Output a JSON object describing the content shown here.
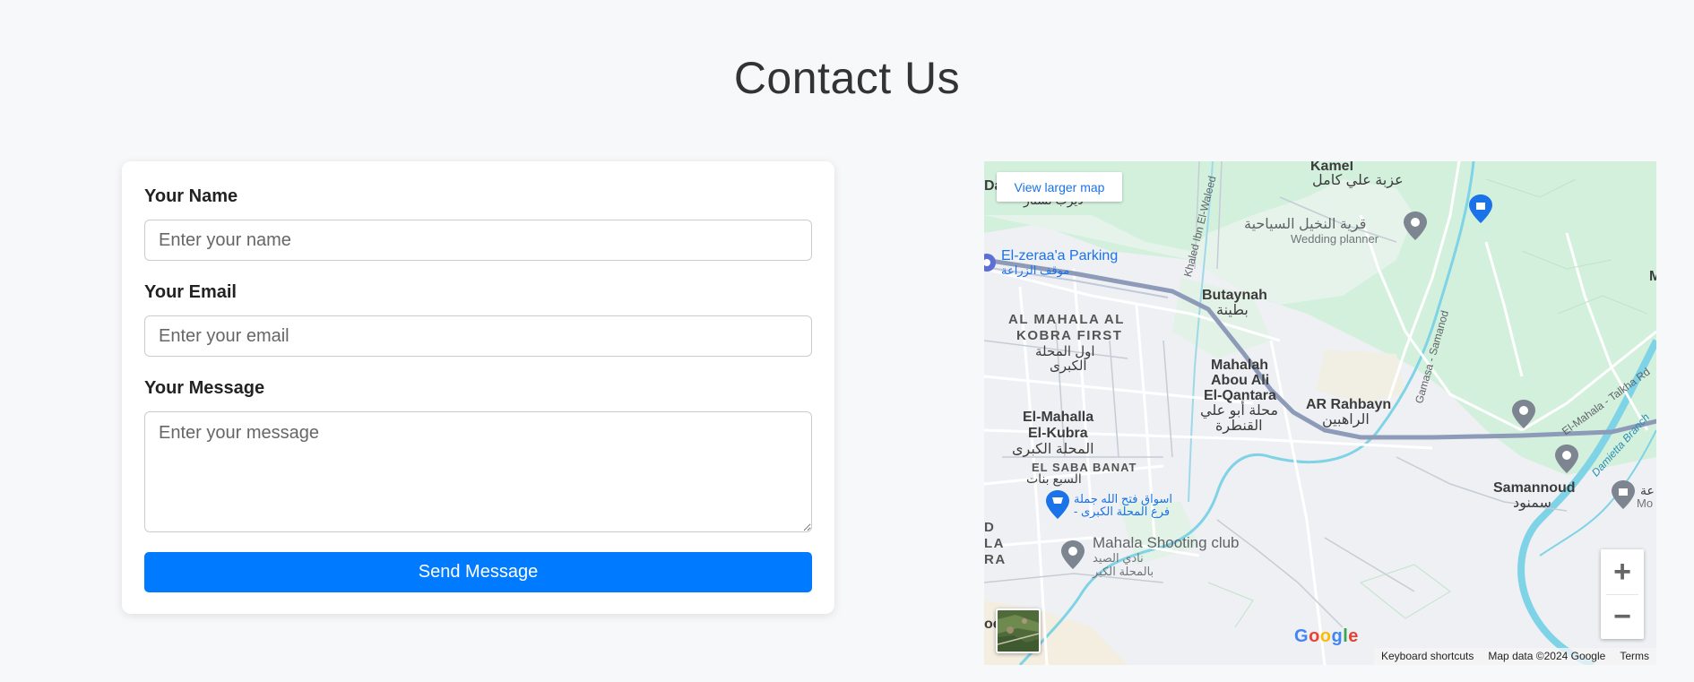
{
  "page": {
    "title": "Contact Us"
  },
  "form": {
    "name_label": "Your Name",
    "name_placeholder": "Enter your name",
    "email_label": "Your Email",
    "email_placeholder": "Enter your email",
    "message_label": "Your Message",
    "message_placeholder": "Enter your message",
    "submit_label": "Send Message",
    "submit_color": "#007bff"
  },
  "map": {
    "view_larger": "View larger map",
    "zoom_in": "+",
    "zoom_out": "−",
    "logo_letters": [
      "G",
      "o",
      "o",
      "g",
      "l",
      "e"
    ],
    "attribution": {
      "shortcuts": "Keyboard shortcuts",
      "data": "Map data ©2024 Google",
      "terms": "Terms"
    },
    "labels": {
      "kamel_en": "Kamel",
      "kamel_ar": "عزبة علي كامل",
      "resort_ar": "قرية النخيل السياحية",
      "wedding": "Wedding planner",
      "parking_en": "El-zeraa'a Parking",
      "parking_ar": "موقف الزراعة",
      "khaled_road": "Khaled Ibn El-Waleed",
      "butaynah_en": "Butaynah",
      "butaynah_ar": "بطينة",
      "kobra_first_1": "AL MAHALA AL",
      "kobra_first_2": "KOBRA FIRST",
      "kobra_first_ar1": "اول المحلة",
      "kobra_first_ar2": "الكبرى",
      "abou_1": "Mahalah",
      "abou_2": "Abou Ali",
      "abou_3": "El-Qantara",
      "abou_ar1": "محلة أبو علي",
      "abou_ar2": "القنطرة",
      "rahbayn_en": "AR Rahbayn",
      "rahbayn_ar": "الراهبين",
      "gamasa": "Gamasa - Samanod",
      "talkha": "El-Mahala - Talkha Rd",
      "damietta": "Damietta Branch",
      "mahalla_1": "El-Mahalla",
      "mahalla_2": "El-Kubra",
      "mahalla_ar": "المحلة الكبرى",
      "sabaa_en": "EL SABA BANAT",
      "sabaa_ar": "السبع بنات",
      "market_ar1": "اسواق فتح الله جملة",
      "market_ar2": "- فرع المحلة الكبرى",
      "shooting_en": "Mahala Shooting club",
      "shooting_ar1": "نادي الصيد",
      "shooting_ar2": "بالمحلة الكبر",
      "samannoud_en": "Samannoud",
      "samannoud_ar": "سمنود",
      "left_da": "Da",
      "left_ar_top": "دیرب نستار",
      "left_d": "D",
      "left_la": "LA",
      "left_ra": "RA",
      "right_m": "M",
      "right_mo": "Mo",
      "right_ar": "عة",
      "bottom_ad": "ad",
      "bottom_be": "oe"
    },
    "colors": {
      "green": "#d3f0dd",
      "urban": "#eef0f3",
      "road": "#ffffff",
      "highway": "#9aa8c2",
      "water": "#7fd3e6",
      "pin_grey": "#7d8590",
      "pin_blue": "#1a73e8"
    }
  }
}
